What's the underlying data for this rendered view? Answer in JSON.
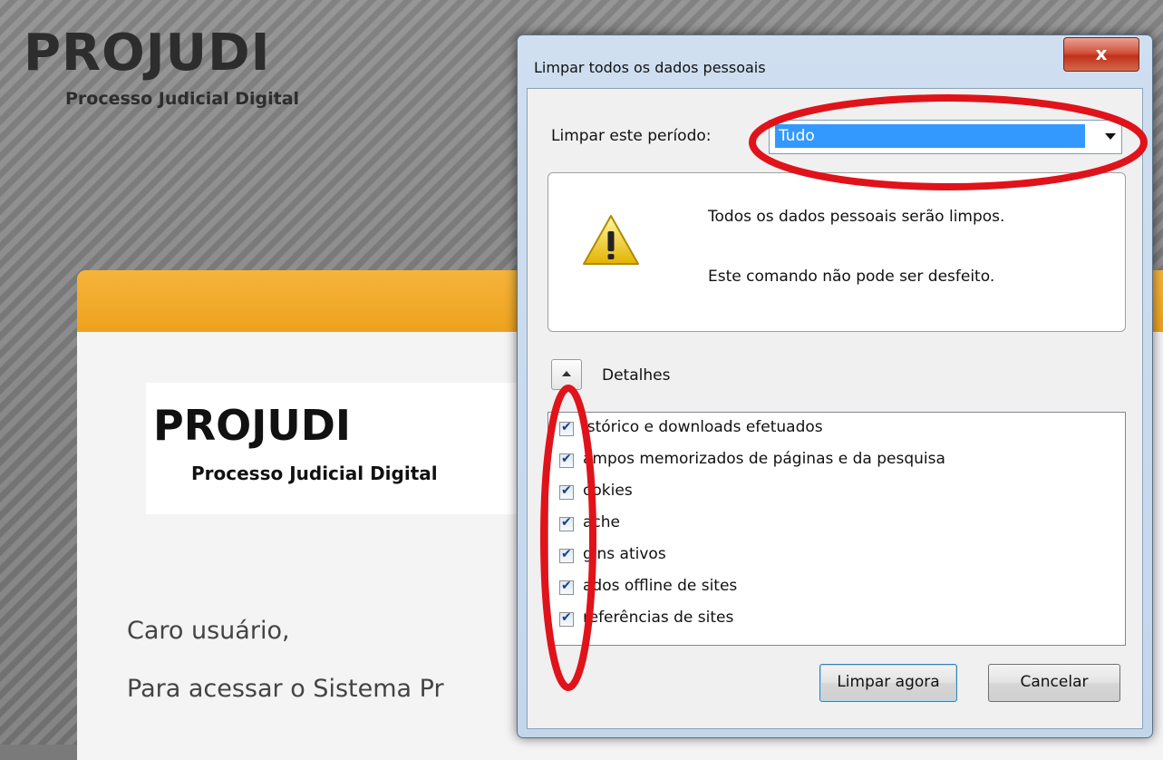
{
  "background": {
    "title": "PROJUDI",
    "subtitle": "Processo Judicial Digital"
  },
  "panel": {
    "logo_title": "PROJUDI",
    "logo_subtitle": "Processo Judicial Digital",
    "text1": "Caro usuário,",
    "text2": "Para acessar o Sistema Pr"
  },
  "dialog": {
    "title": "Limpar todos os dados pessoais",
    "close_label": "x",
    "period_label": "Limpar este período:",
    "period_value": "Tudo",
    "info_line1": "Todos os dados pessoais serão limpos.",
    "info_line2": "Este comando não pode ser desfeito.",
    "details_label": "Detalhes",
    "items": [
      {
        "label": "istórico e downloads efetuados",
        "checked": true
      },
      {
        "label": "ampos memorizados de páginas e da pesquisa",
        "checked": true
      },
      {
        "label": "ookies",
        "checked": true
      },
      {
        "label": "ache",
        "checked": true
      },
      {
        "label": "gins ativos",
        "checked": true
      },
      {
        "label": "ados offline de sites",
        "checked": true
      },
      {
        "label": "referências de sites",
        "checked": true
      }
    ],
    "clear_button": "Limpar agora",
    "cancel_button": "Cancelar"
  },
  "colors": {
    "highlight": "#3399ff",
    "annotation": "#e0131a",
    "orange_bar": "#f0a526"
  },
  "icons": [
    "warning-icon",
    "close-icon",
    "dropdown-arrow-icon",
    "expand-icon"
  ]
}
